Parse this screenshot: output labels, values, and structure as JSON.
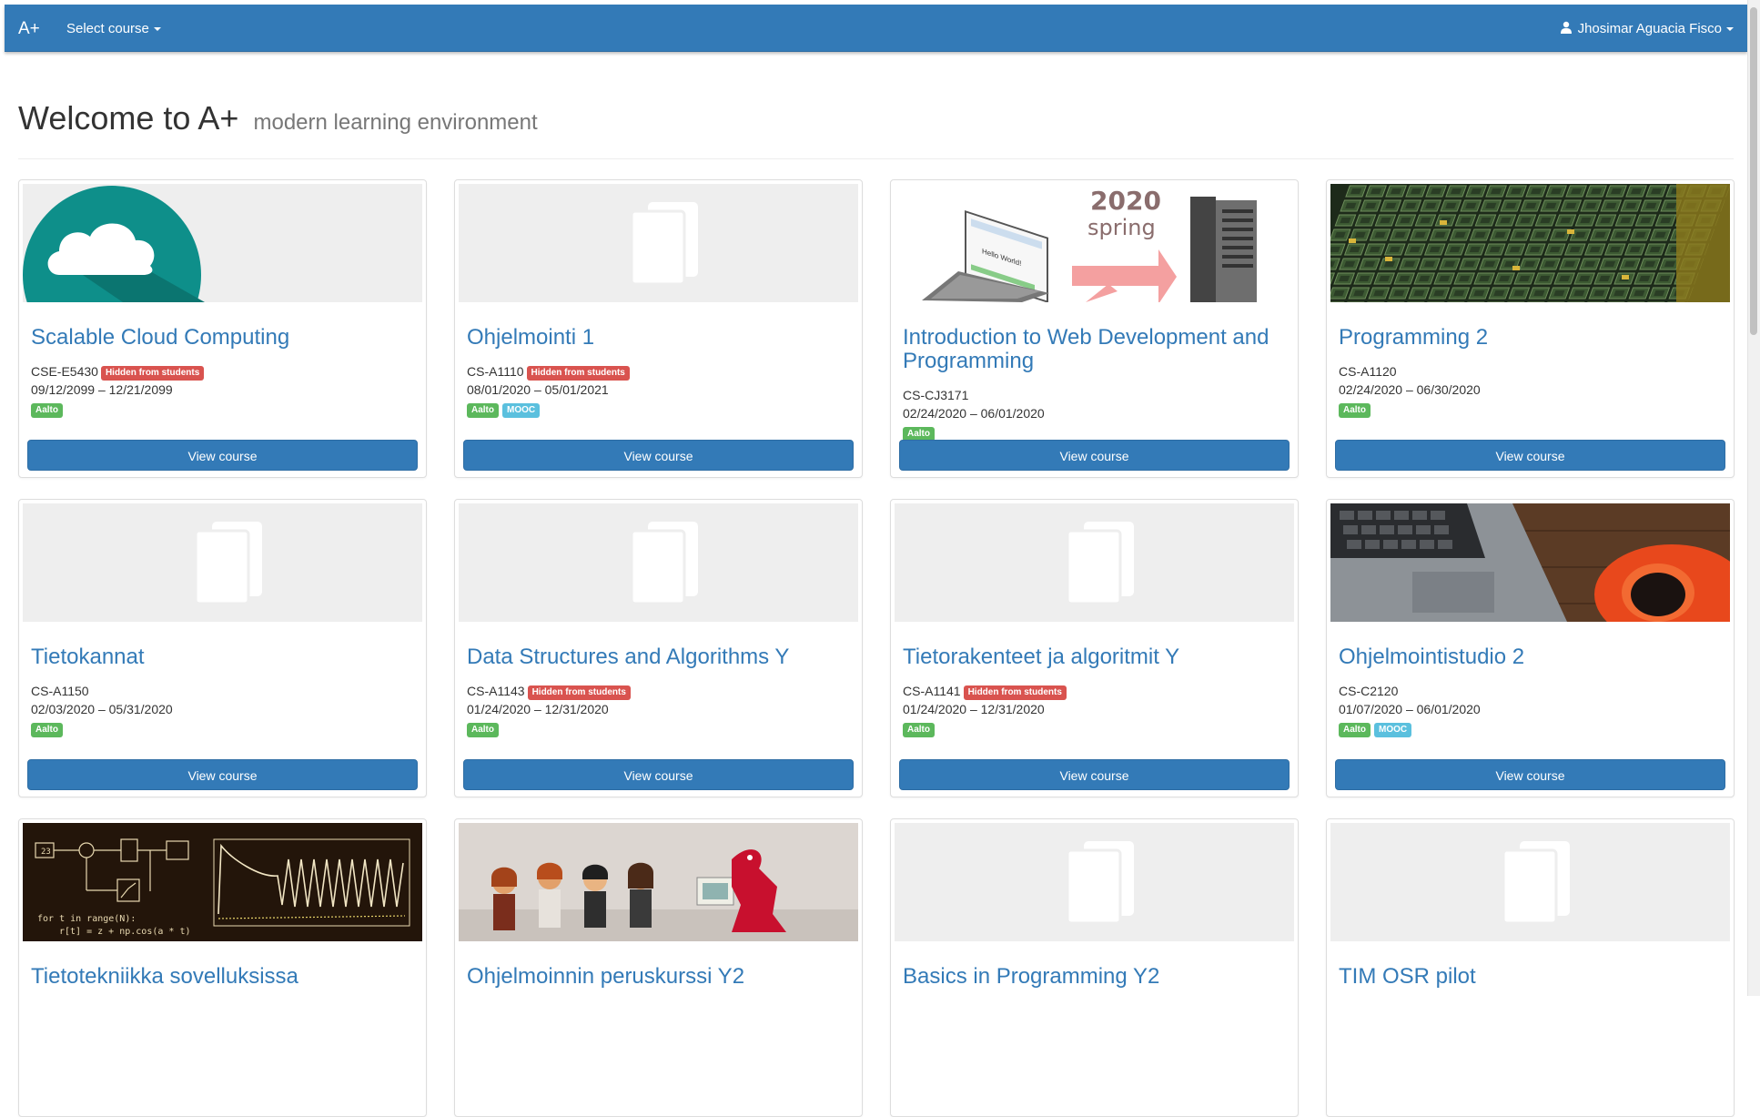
{
  "navbar": {
    "brand": "A+",
    "select_course": "Select course",
    "user": "Jhosimar Aguacia Fisco"
  },
  "header": {
    "title": "Welcome to A+",
    "subtitle": "modern learning environment"
  },
  "colors": {
    "primary": "#337ab7",
    "danger": "#d9534f",
    "success": "#5cb85c",
    "info": "#5bc0de"
  },
  "courses": [
    {
      "title": "Scalable Cloud Computing",
      "code": "CSE-E5430",
      "hidden": "Hidden from students",
      "dates": "09/12/2099 – 12/21/2099",
      "tags": [
        "Aalto"
      ],
      "button": "View course",
      "image": "cloud-logo"
    },
    {
      "title": "Ohjelmointi 1",
      "code": "CS-A1110",
      "hidden": "Hidden from students",
      "dates": "08/01/2020 – 05/01/2021",
      "tags": [
        "Aalto",
        "MOOC"
      ],
      "button": "View course",
      "image": "book-placeholder"
    },
    {
      "title": "Introduction to Web Development and Programming",
      "code": "CS-CJ3171",
      "hidden": "",
      "dates": "02/24/2020 – 06/01/2020",
      "tags": [
        "Aalto"
      ],
      "button": "View course",
      "image": "web-dev-banner",
      "image_text_1": "2020",
      "image_text_2": "spring",
      "image_screen_text": "Hello World!"
    },
    {
      "title": "Programming 2",
      "code": "CS-A1120",
      "hidden": "",
      "dates": "02/24/2020 – 06/30/2020",
      "tags": [
        "Aalto"
      ],
      "button": "View course",
      "image": "circuit-chip-photo"
    },
    {
      "title": "Tietokannat",
      "code": "CS-A1150",
      "hidden": "",
      "dates": "02/03/2020 – 05/31/2020",
      "tags": [
        "Aalto"
      ],
      "button": "View course",
      "image": "book-placeholder"
    },
    {
      "title": "Data Structures and Algorithms Y",
      "code": "CS-A1143",
      "hidden": "Hidden from students",
      "dates": "01/24/2020 – 12/31/2020",
      "tags": [
        "Aalto"
      ],
      "button": "View course",
      "image": "book-placeholder"
    },
    {
      "title": "Tietorakenteet ja algoritmit Y",
      "code": "CS-A1141",
      "hidden": "Hidden from students",
      "dates": "01/24/2020 – 12/31/2020",
      "tags": [
        "Aalto"
      ],
      "button": "View course",
      "image": "book-placeholder"
    },
    {
      "title": "Ohjelmointistudio 2",
      "code": "CS-C2120",
      "hidden": "",
      "dates": "01/07/2020 – 06/01/2020",
      "tags": [
        "Aalto",
        "MOOC"
      ],
      "button": "View course",
      "image": "laptop-coffee-photo"
    },
    {
      "title": "Tietotekniikka sovelluksissa",
      "image": "signal-diagram",
      "image_text_1": "23",
      "image_text_2": "for t in range(N):",
      "image_text_3": "r[t] = z + np.cos(a * t)"
    },
    {
      "title": "Ohjelmoinnin peruskurssi Y2",
      "image": "lego-figures-photo"
    },
    {
      "title": "Basics in Programming Y2",
      "image": "book-placeholder"
    },
    {
      "title": "TIM OSR pilot",
      "image": "book-placeholder"
    }
  ]
}
